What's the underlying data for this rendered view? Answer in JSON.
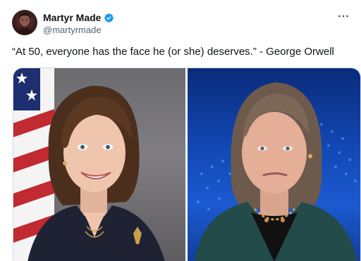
{
  "author": {
    "display_name": "Martyr Made",
    "handle": "@martyrmade",
    "avatar_icon": "profile-portrait-avatar",
    "verified_icon": "verified-badge-icon",
    "verified_color": "#1d9bf0"
  },
  "menu": {
    "icon": "more-horizontal-icon"
  },
  "tweet": {
    "text": "“At 50, everyone has the face he (or she) deserves.” - George Orwell"
  },
  "media": {
    "images": [
      {
        "description_icon": "photo-left"
      },
      {
        "description_icon": "photo-right"
      }
    ]
  }
}
